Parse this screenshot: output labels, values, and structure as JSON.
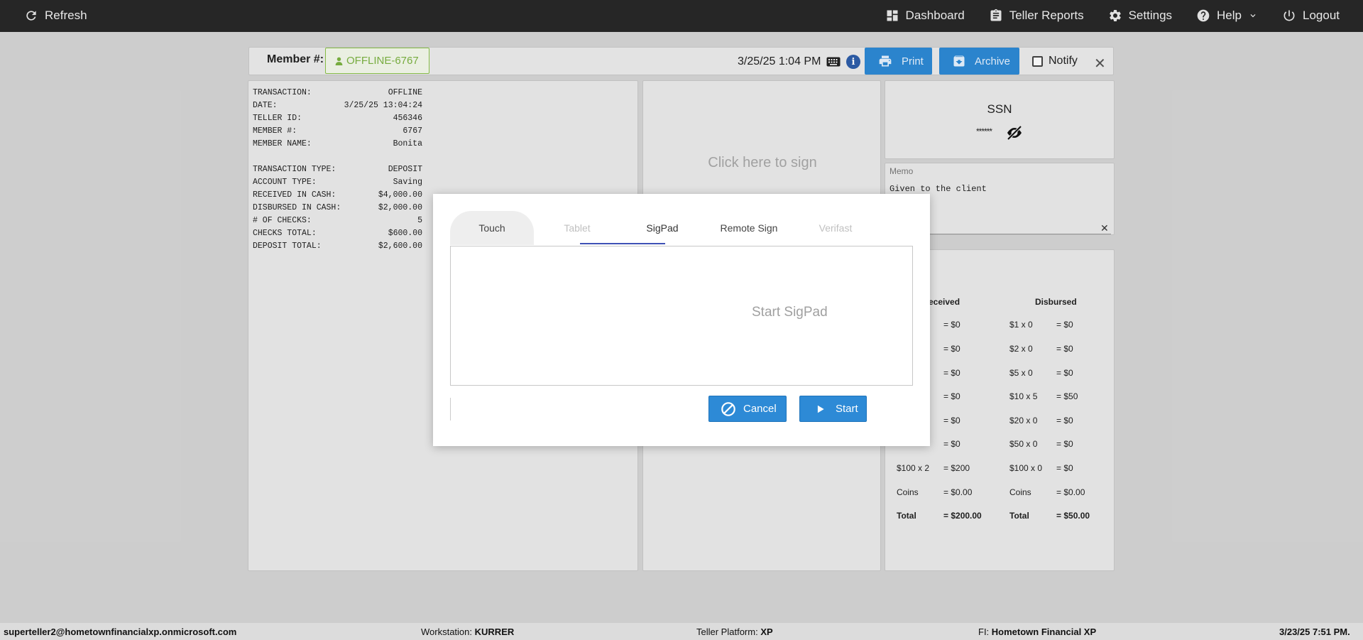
{
  "topbar": {
    "refresh_label": "Refresh",
    "dashboard_label": "Dashboard",
    "teller_reports_label": "Teller Reports",
    "settings_label": "Settings",
    "help_label": "Help",
    "logout_label": "Logout"
  },
  "header": {
    "member_label": "Member #:",
    "member_value": "OFFLINE-6767",
    "datetime": "3/25/25 1:04 PM",
    "info_icon_glyph": "i",
    "print_label": "Print",
    "archive_label": "Archive",
    "notify_label": "Notify"
  },
  "receipt": {
    "group1": [
      {
        "label": "TRANSACTION:",
        "value": "OFFLINE"
      },
      {
        "label": "DATE:",
        "value": "3/25/25 13:04:24"
      },
      {
        "label": "TELLER ID:",
        "value": "456346"
      },
      {
        "label": "MEMBER #:",
        "value": "6767"
      },
      {
        "label": "MEMBER NAME:",
        "value": "Bonita"
      }
    ],
    "group2": [
      {
        "label": "TRANSACTION TYPE:",
        "value": "DEPOSIT"
      },
      {
        "label": "ACCOUNT TYPE:",
        "value": "Saving"
      },
      {
        "label": "RECEIVED IN CASH:",
        "value": "$4,000.00"
      },
      {
        "label": "DISBURSED IN CASH:",
        "value": "$2,000.00"
      },
      {
        "label": "# OF CHECKS:",
        "value": "5"
      },
      {
        "label": "CHECKS TOTAL:",
        "value": "$600.00"
      },
      {
        "label": "DEPOSIT TOTAL:",
        "value": "$2,600.00"
      }
    ]
  },
  "signature": {
    "prompt": "Click here to sign"
  },
  "ssn": {
    "label": "SSN",
    "masked_value": "******"
  },
  "memo": {
    "label": "Memo",
    "text": "Given to the client",
    "clear_glyph": "✕"
  },
  "cash": {
    "received_header": "eceived",
    "disbursed_header": "Disbursed",
    "received_rows": [
      {
        "denom": "",
        "amount": "= $0"
      },
      {
        "denom": "",
        "amount": "= $0"
      },
      {
        "denom": "",
        "amount": "= $0"
      },
      {
        "denom": "",
        "amount": "= $0"
      },
      {
        "denom": "",
        "amount": "= $0"
      },
      {
        "denom": "",
        "amount": "= $0"
      },
      {
        "denom": "$100 x 2",
        "amount": "= $200"
      },
      {
        "denom": "Coins",
        "amount": "= $0.00"
      },
      {
        "denom": "Total",
        "amount": "= $200.00"
      }
    ],
    "disbursed_rows": [
      {
        "denom": "$1 x 0",
        "amount": "= $0"
      },
      {
        "denom": "$2 x 0",
        "amount": "= $0"
      },
      {
        "denom": "$5 x 0",
        "amount": "= $0"
      },
      {
        "denom": "$10 x 5",
        "amount": "= $50"
      },
      {
        "denom": "$20 x 0",
        "amount": "= $0"
      },
      {
        "denom": "$50 x 0",
        "amount": "= $0"
      },
      {
        "denom": "$100 x 0",
        "amount": "= $0"
      },
      {
        "denom": "Coins",
        "amount": "= $0.00"
      },
      {
        "denom": "Total",
        "amount": "= $50.00"
      }
    ]
  },
  "modal": {
    "tabs": [
      "Touch",
      "Tablet",
      "SigPad",
      "Remote Sign",
      "Verifast"
    ],
    "active_tab": "SigPad",
    "start_sigpad_text": "Start SigPad",
    "cancel_label": "Cancel",
    "start_label": "Start"
  },
  "statusbar": {
    "user": "superteller2@hometownfinancialxp.onmicrosoft.com",
    "workstation_label": "Workstation:",
    "workstation_value": "KURRER",
    "platform_label": "Teller Platform:",
    "platform_value": "XP",
    "fi_label": "FI:",
    "fi_value": "Hometown Financial XP",
    "datetime": "3/23/25 7:51 PM."
  },
  "colors": {
    "accent_blue": "#2d8ad6",
    "member_badge_green": "#7cb342",
    "topbar_bg": "#262626",
    "tab_underline": "#3f51b5"
  }
}
